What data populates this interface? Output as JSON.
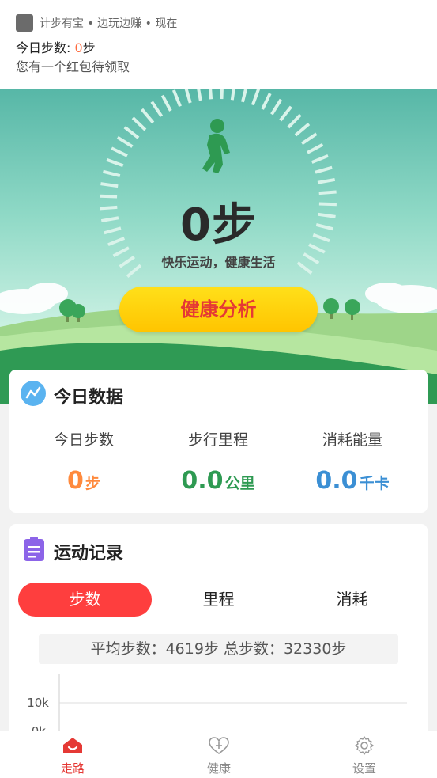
{
  "notification": {
    "meta": "计步有宝 • 边玩边赚 • 现在",
    "line1_prefix": "今日步数: ",
    "line1_value": "0",
    "line1_suffix": "步",
    "line2": "您有一个红包待领取"
  },
  "hero": {
    "steps": "0步",
    "slogan": "快乐运动，健康生活",
    "analysis_button": "健康分析"
  },
  "today": {
    "title": "今日数据",
    "stats": [
      {
        "label": "今日步数",
        "value": "0",
        "unit": "步"
      },
      {
        "label": "步行里程",
        "value": "0.0",
        "unit": "公里"
      },
      {
        "label": "消耗能量",
        "value": "0.0",
        "unit": "千卡"
      }
    ]
  },
  "records": {
    "title": "运动记录",
    "tabs": [
      "步数",
      "里程",
      "消耗"
    ],
    "active_tab": "步数",
    "summary": "平均步数：4619步 总步数：32330步",
    "chart_labels": [
      "10k",
      "0k"
    ]
  },
  "nav": [
    {
      "label": "走路",
      "icon": "home-icon",
      "active": true
    },
    {
      "label": "健康",
      "icon": "heart-plus-icon",
      "active": false
    },
    {
      "label": "设置",
      "icon": "gear-icon",
      "active": false
    }
  ],
  "colors": {
    "accent_red": "#fe3e3e",
    "button_yellow": "#ffd500",
    "orange": "#ff8a3d",
    "green": "#2e9a52",
    "blue": "#3b8fd4"
  }
}
